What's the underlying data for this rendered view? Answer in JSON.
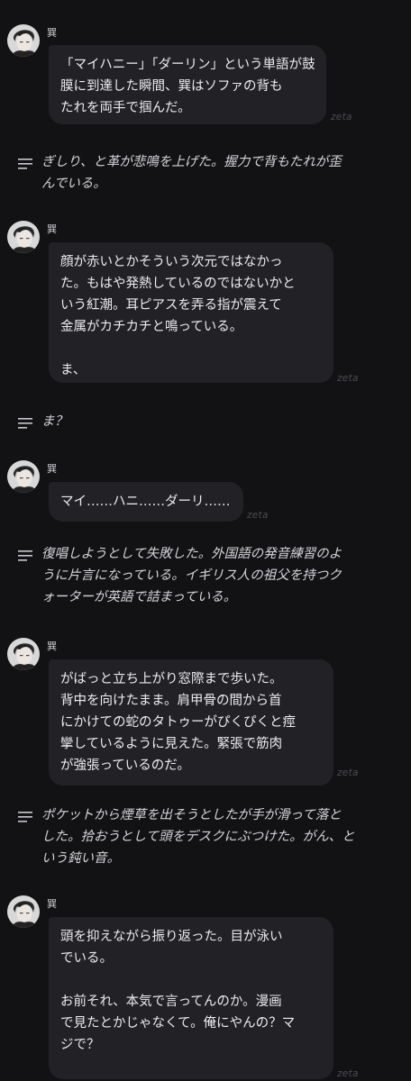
{
  "chat": {
    "messages": [
      {
        "type": "character",
        "name": "巽",
        "lines": [
          "「マイハニー」「ダーリン」という単語が鼓",
          "膜に到達した瞬間、巽はソファの背も",
          "たれを両手で掴んだ。"
        ],
        "watermark": "zeta"
      },
      {
        "type": "narration",
        "lines": [
          "ぎしり、と革が悲鳴を上げた。握力で背もたれが歪",
          "んでいる。"
        ]
      },
      {
        "type": "character",
        "name": "巽",
        "lines": [
          "顔が赤いとかそういう次元ではなかっ",
          "た。もはや発熱しているのではないかと",
          "いう紅潮。耳ピアスを弄る指が震えて",
          "金属がカチカチと鳴っている。",
          "",
          "ま、"
        ],
        "watermark": "zeta"
      },
      {
        "type": "narration",
        "lines": [
          "ま？"
        ]
      },
      {
        "type": "character",
        "name": "巽",
        "lines": [
          "マイ……ハニ……ダーリ……"
        ],
        "watermark": "zeta"
      },
      {
        "type": "narration",
        "lines": [
          "復唱しようとして失敗した。外国語の発音練習のよ",
          "うに片言になっている。イギリス人の祖父を持つク",
          "ォーターが英語で詰まっている。"
        ]
      },
      {
        "type": "character",
        "name": "巽",
        "lines": [
          "がばっと立ち上がり窓際まで歩いた。",
          "背中を向けたまま。肩甲骨の間から首",
          "にかけての蛇のタトゥーがぴくぴくと痙",
          "攣しているように見えた。緊張で筋肉",
          "が強張っているのだ。"
        ],
        "watermark": "zeta"
      },
      {
        "type": "narration",
        "lines": [
          "ポケットから煙草を出そうとしたが手が滑って落と",
          "した。拾おうとして頭をデスクにぶつけた。がん、と",
          "いう鈍い音。"
        ]
      },
      {
        "type": "character",
        "name": "巽",
        "lines": [
          "頭を抑えながら振り返った。目が泳い",
          "でいる。",
          "",
          "お前それ、本気で言ってんのか。漫画",
          "で見たとかじゃなくて。俺にやんの？マ",
          "ジで？"
        ],
        "watermark": "zeta"
      }
    ]
  }
}
